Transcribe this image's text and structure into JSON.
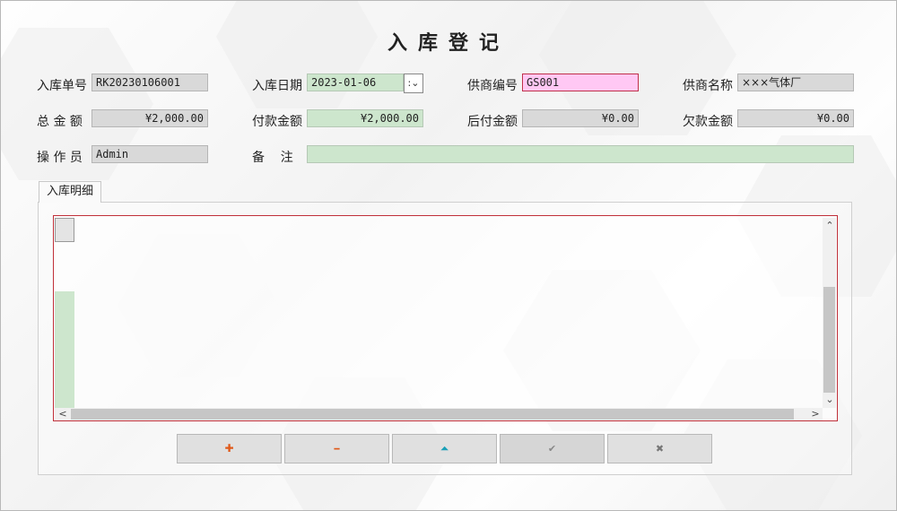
{
  "form": {
    "title": "入库登记",
    "labels": {
      "order_no": "入库单号",
      "date": "入库日期",
      "supplier_code": "供商编号",
      "supplier_name": "供商名称",
      "total": "总 金 额",
      "paid": "付款金额",
      "deferred": "后付金额",
      "owed": "欠款金额",
      "operator": "操 作 员",
      "remark": "备    注"
    },
    "values": {
      "order_no": "RK20230106001",
      "date": "2023-01-06",
      "supplier_code": "GS001",
      "supplier_name": "×××气体厂",
      "total": "¥2,000.00",
      "paid": "¥2,000.00",
      "deferred": "¥0.00",
      "owed": "¥0.00",
      "operator": "Admin",
      "remark": ""
    },
    "date_dropdown_icon": ":⌄"
  },
  "detail_tab": {
    "label": "入库明细"
  },
  "grid": {
    "scroll_up": "⌃",
    "scroll_down": "⌄",
    "scroll_left": "<",
    "scroll_right": ">"
  },
  "toolbar": {
    "add_label": "✚",
    "remove_label": "━",
    "up_label": "⏶",
    "confirm_label": "✔",
    "cancel_label": "✖",
    "colors": {
      "add": "#e05a1a",
      "remove": "#e05a1a",
      "up": "#1aa0b8"
    }
  }
}
